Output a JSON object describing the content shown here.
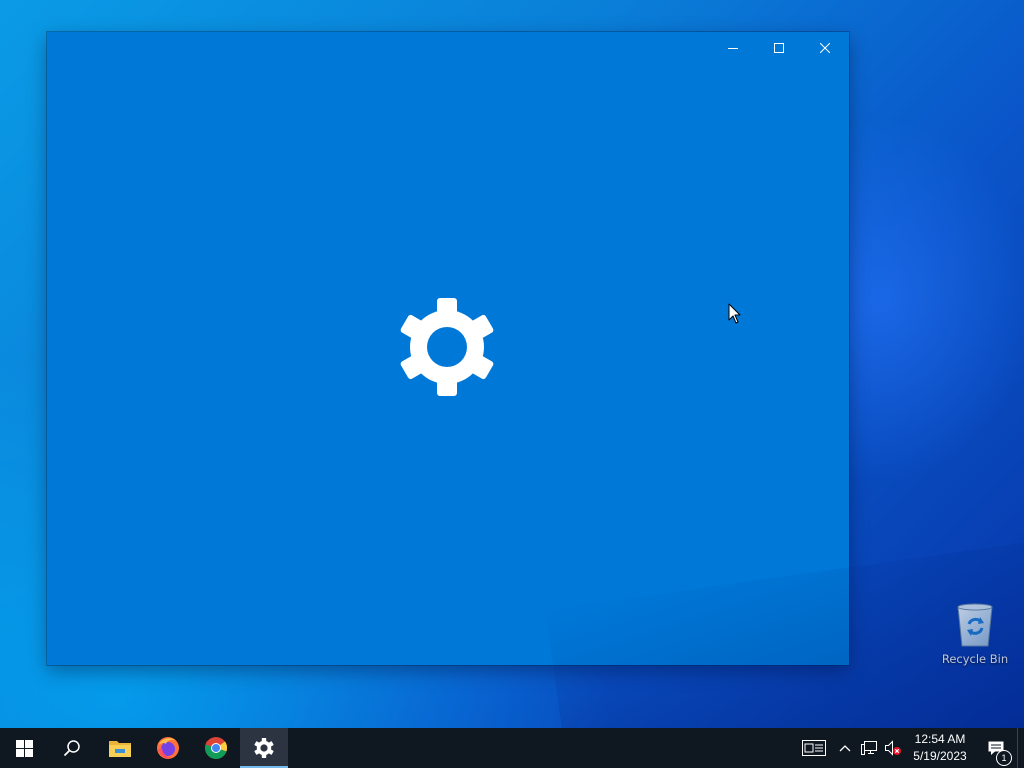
{
  "window": {
    "app": "Settings",
    "background_color": "#0078d7",
    "caption_buttons": [
      "minimize",
      "maximize",
      "close"
    ],
    "splash_icon": "gear-icon"
  },
  "desktop": {
    "icons": [
      {
        "label": "Recycle Bin",
        "icon": "recycle-bin-icon"
      }
    ]
  },
  "taskbar": {
    "apps": [
      {
        "name": "start",
        "icon": "windows-logo-icon"
      },
      {
        "name": "search",
        "icon": "search-icon"
      },
      {
        "name": "file-explorer",
        "icon": "folder-icon"
      },
      {
        "name": "firefox",
        "icon": "firefox-icon"
      },
      {
        "name": "chrome",
        "icon": "chrome-icon"
      },
      {
        "name": "settings",
        "icon": "gear-icon",
        "active": true
      }
    ],
    "tray": {
      "icons": [
        "news-icon",
        "chevron-up-icon",
        "network-icon",
        "volume-muted-icon"
      ],
      "time": "12:54 AM",
      "date": "5/19/2023",
      "notification_count": "1"
    }
  },
  "colors": {
    "accent": "#0078d7",
    "taskbar": "#0f1720",
    "active_indicator": "#76b9ed"
  }
}
